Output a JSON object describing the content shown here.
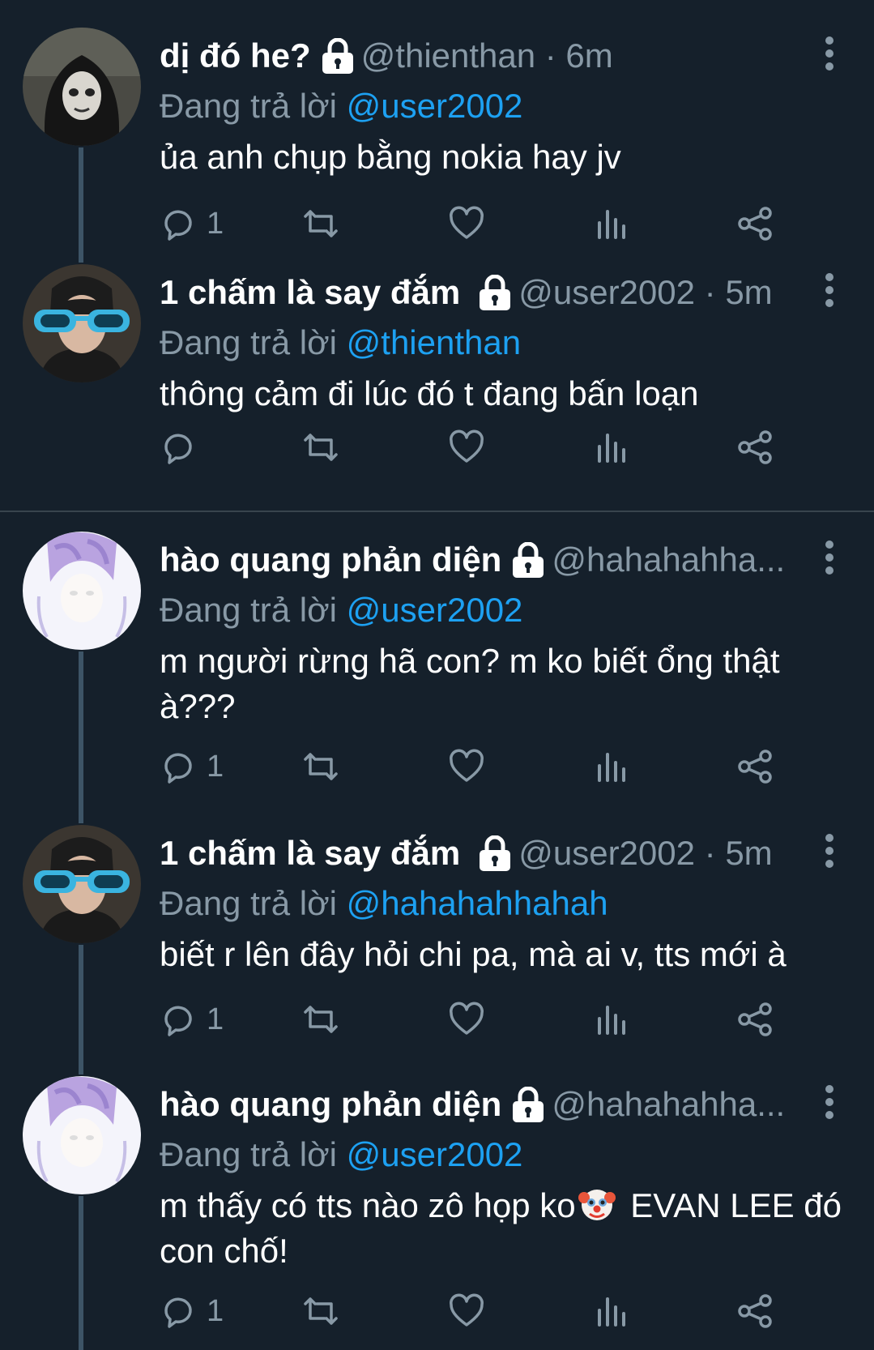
{
  "reply_prefix": "Đang trả lời",
  "tweets": [
    {
      "name": "dị đó he?",
      "handle": "@thienthan · 6m",
      "reply_to": "@user2002",
      "text": "ủa anh chụp bằng nokia hay jv",
      "reply_count": "1",
      "avatar": "nun-mask-avatar"
    },
    {
      "name": "1 chấm là say đắm",
      "handle": "@user2002 · 5m",
      "reply_to": "@thienthan",
      "text": "thông cảm đi lúc đó t đang bấn loạn",
      "reply_count": "",
      "avatar": "sunglasses-avatar"
    },
    {
      "name": "hào quang phản diện",
      "handle": "@hahahahha...",
      "reply_to": "@user2002",
      "text": "m người rừng hã con? m ko biết ổng thật à???",
      "reply_count": "1",
      "avatar": "purple-hair-avatar"
    },
    {
      "name": "1 chấm là say đắm",
      "handle": "@user2002 · 5m",
      "reply_to": "@hahahahhahah",
      "text": "biết r lên đây hỏi chi pa, mà ai v, tts mới à",
      "reply_count": "1",
      "avatar": "sunglasses-avatar"
    },
    {
      "name": "hào quang phản diện",
      "handle": "@hahahahha...",
      "reply_to": "@user2002",
      "text_before_emoji": "m thấy có tts nào zô họp ko",
      "text_after_emoji": " EVAN LEE đó con chố!",
      "reply_count": "1",
      "avatar": "purple-hair-avatar"
    }
  ],
  "colors": {
    "background": "#15202b",
    "secondary_text": "#8899a6",
    "mention": "#1da1f2",
    "divider": "#38444d"
  },
  "icons": [
    "lock-icon",
    "more-icon",
    "reply-icon",
    "retweet-icon",
    "like-icon",
    "analytics-icon",
    "share-icon",
    "clown-face-emoji"
  ]
}
